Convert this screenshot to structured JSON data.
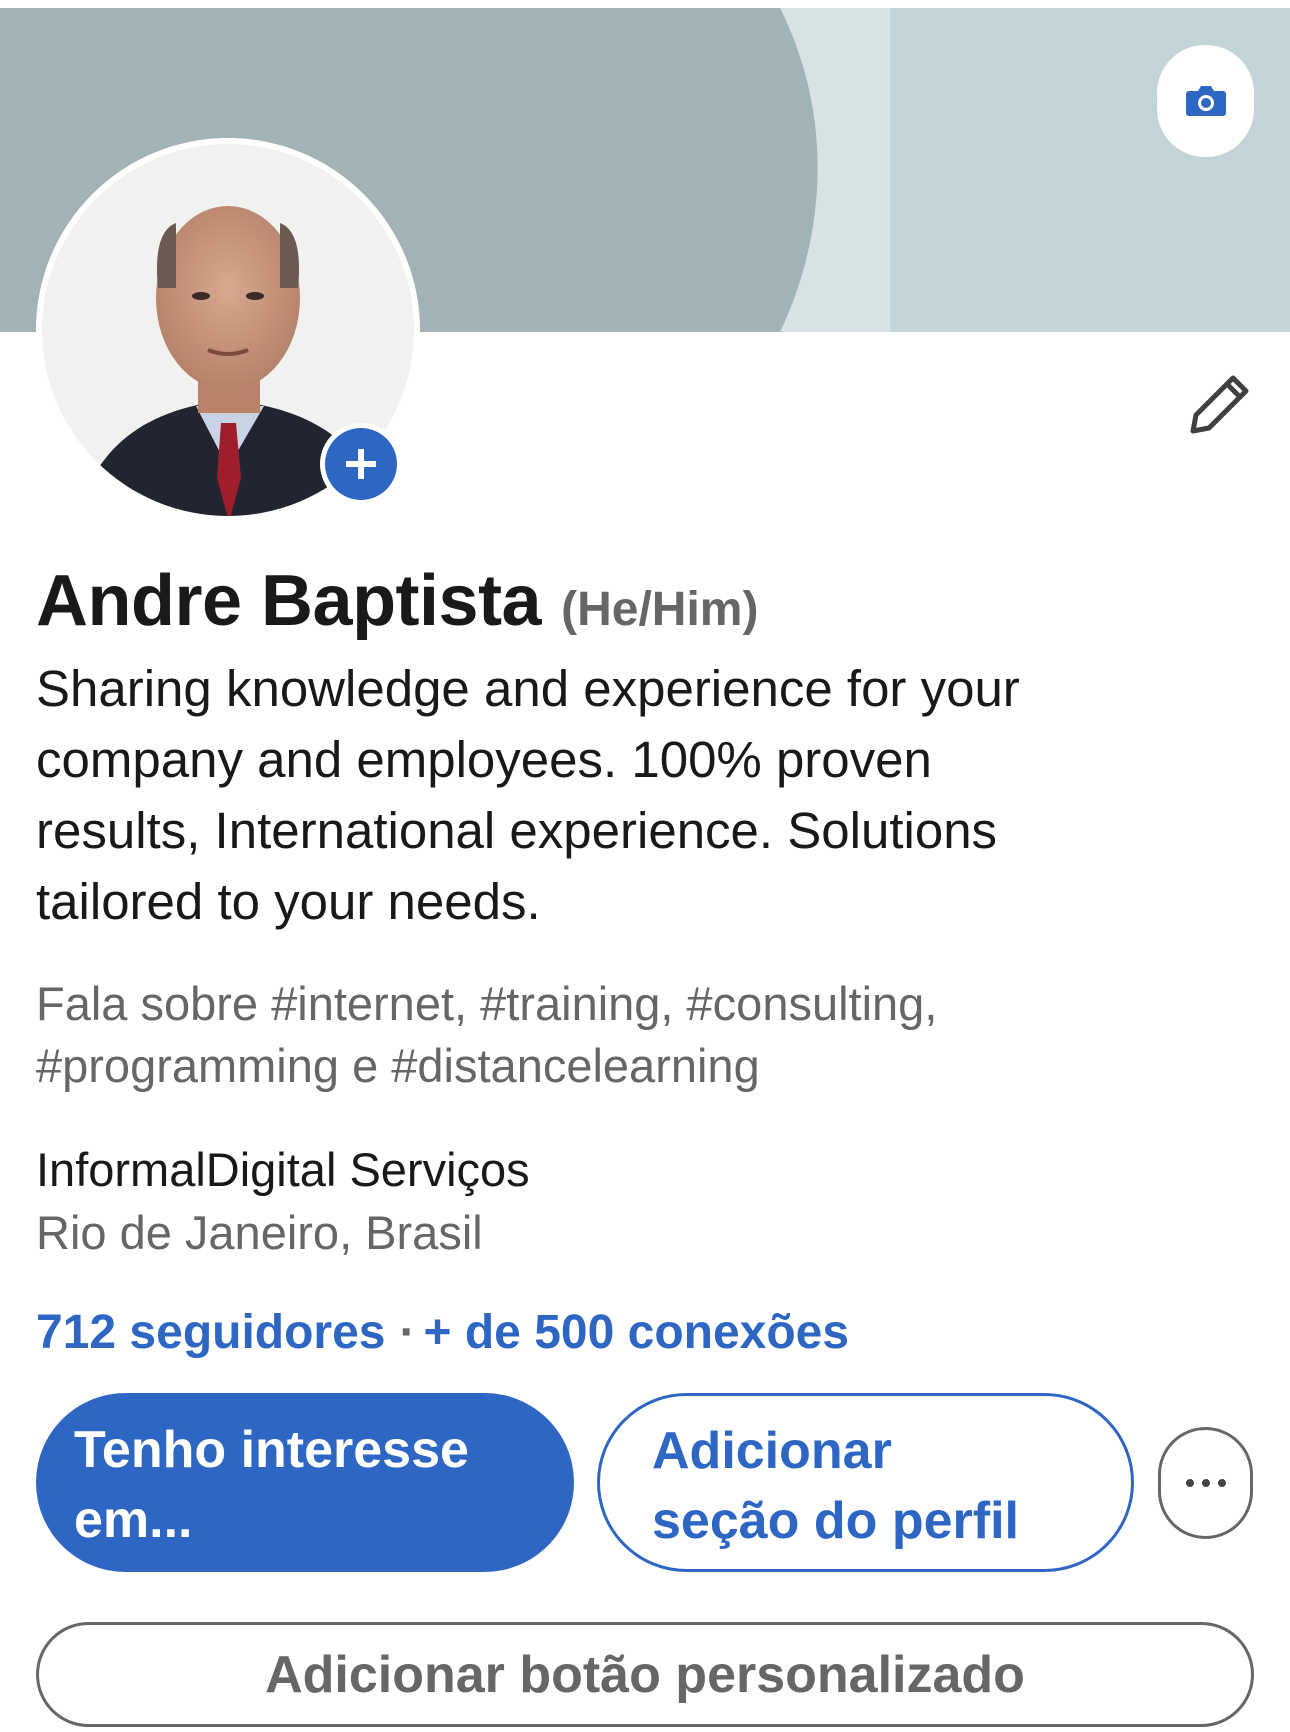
{
  "profile": {
    "name": "Andre Baptista",
    "pronouns": "(He/Him)",
    "headline_lines": [
      "Sharing knowledge and experience for your",
      "company and employees. 100% proven",
      "results, International experience. Solutions",
      "tailored to your needs."
    ],
    "talks_about_lines": [
      "Fala sobre #internet, #training, #consulting,",
      "#programming e #distancelearning"
    ],
    "company": "InformalDigital Serviços",
    "location": "Rio de Janeiro, Brasil",
    "followers": "712 seguidores",
    "separator": "·",
    "connections": "+ de 500 conexões"
  },
  "actions": {
    "open_to_lines": [
      "Tenho interesse",
      "em..."
    ],
    "add_section_lines": [
      "Adicionar",
      "seção do perfil"
    ],
    "custom_button": "Adicionar botão personalizado"
  },
  "icons": {
    "cover_camera": "camera-icon",
    "avatar_add": "plus-icon",
    "edit_intro": "pencil-icon",
    "more_actions": "ellipsis-icon"
  },
  "colors": {
    "accent": "#2e66c3",
    "cover_left": "#a2b3b5",
    "cover_mid": "#d7e2e4",
    "cover_right": "#c3d4d6",
    "text_primary": "#191919",
    "text_secondary": "#666666"
  }
}
